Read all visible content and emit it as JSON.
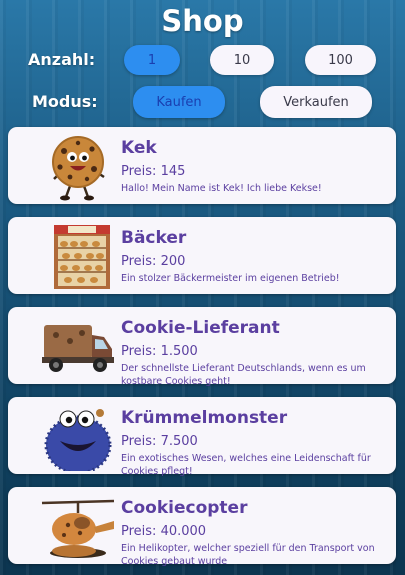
{
  "header": {
    "title": "Shop"
  },
  "anzahl": {
    "label": "Anzahl:",
    "options": [
      "1",
      "10",
      "100"
    ],
    "selected": "1"
  },
  "modus": {
    "label": "Modus:",
    "options": [
      "Kaufen",
      "Verkaufen"
    ],
    "selected": "Kaufen"
  },
  "items": [
    {
      "name": "Kek",
      "price": "Preis: 145",
      "description": "Hallo! Mein Name ist Kek! Ich liebe Kekse!",
      "image": "cookie-character-image"
    },
    {
      "name": "Bäcker",
      "price": "Preis: 200",
      "description": "Ein stolzer Bäckermeister im eigenen Betrieb!",
      "image": "bakery-shop-image"
    },
    {
      "name": "Cookie-Lieferant",
      "price": "Preis: 1.500",
      "description": "Der schnellste Lieferant Deutschlands, wenn es um kostbare Cookies geht!",
      "image": "delivery-truck-image"
    },
    {
      "name": "Krümmelmonster",
      "price": "Preis: 7.500",
      "description": "Ein exotisches Wesen, welches eine Leidenschaft für Cookies pflegt!",
      "image": "cookie-monster-image"
    },
    {
      "name": "Cookiecopter",
      "price": "Preis: 40.000",
      "description": "Ein Helikopter, welcher speziell für den Transport von Cookies gebaut wurde",
      "image": "cookie-helicopter-image"
    }
  ]
}
